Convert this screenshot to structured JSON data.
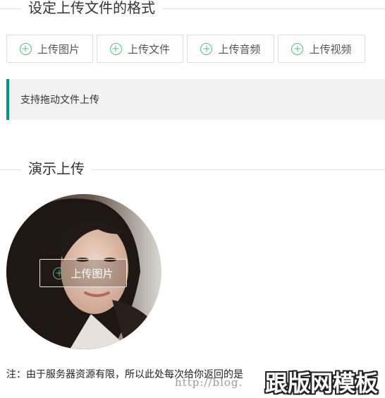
{
  "sections": {
    "format": {
      "title": "设定上传文件的格式"
    },
    "demo": {
      "title": "演示上传"
    }
  },
  "upload_buttons": [
    {
      "label": "上传图片",
      "icon": "plus-circle-icon"
    },
    {
      "label": "上传文件",
      "icon": "plus-circle-icon"
    },
    {
      "label": "上传音频",
      "icon": "plus-circle-icon"
    },
    {
      "label": "上传视频",
      "icon": "plus-circle-icon"
    }
  ],
  "quote": {
    "text": "支持拖动文件上传"
  },
  "demo": {
    "overlay_button_label": "上传图片",
    "overlay_icon": "plus-circle-icon"
  },
  "note": {
    "text": "注：由于服务器资源有限，所以此处每次给你返回的是"
  },
  "watermark": {
    "url_text": "http://blog.",
    "brand_text": "跟版网模板"
  },
  "colors": {
    "accent_green": "#5fb878",
    "quote_border": "#009688",
    "quote_bg": "#f2f2f2"
  }
}
